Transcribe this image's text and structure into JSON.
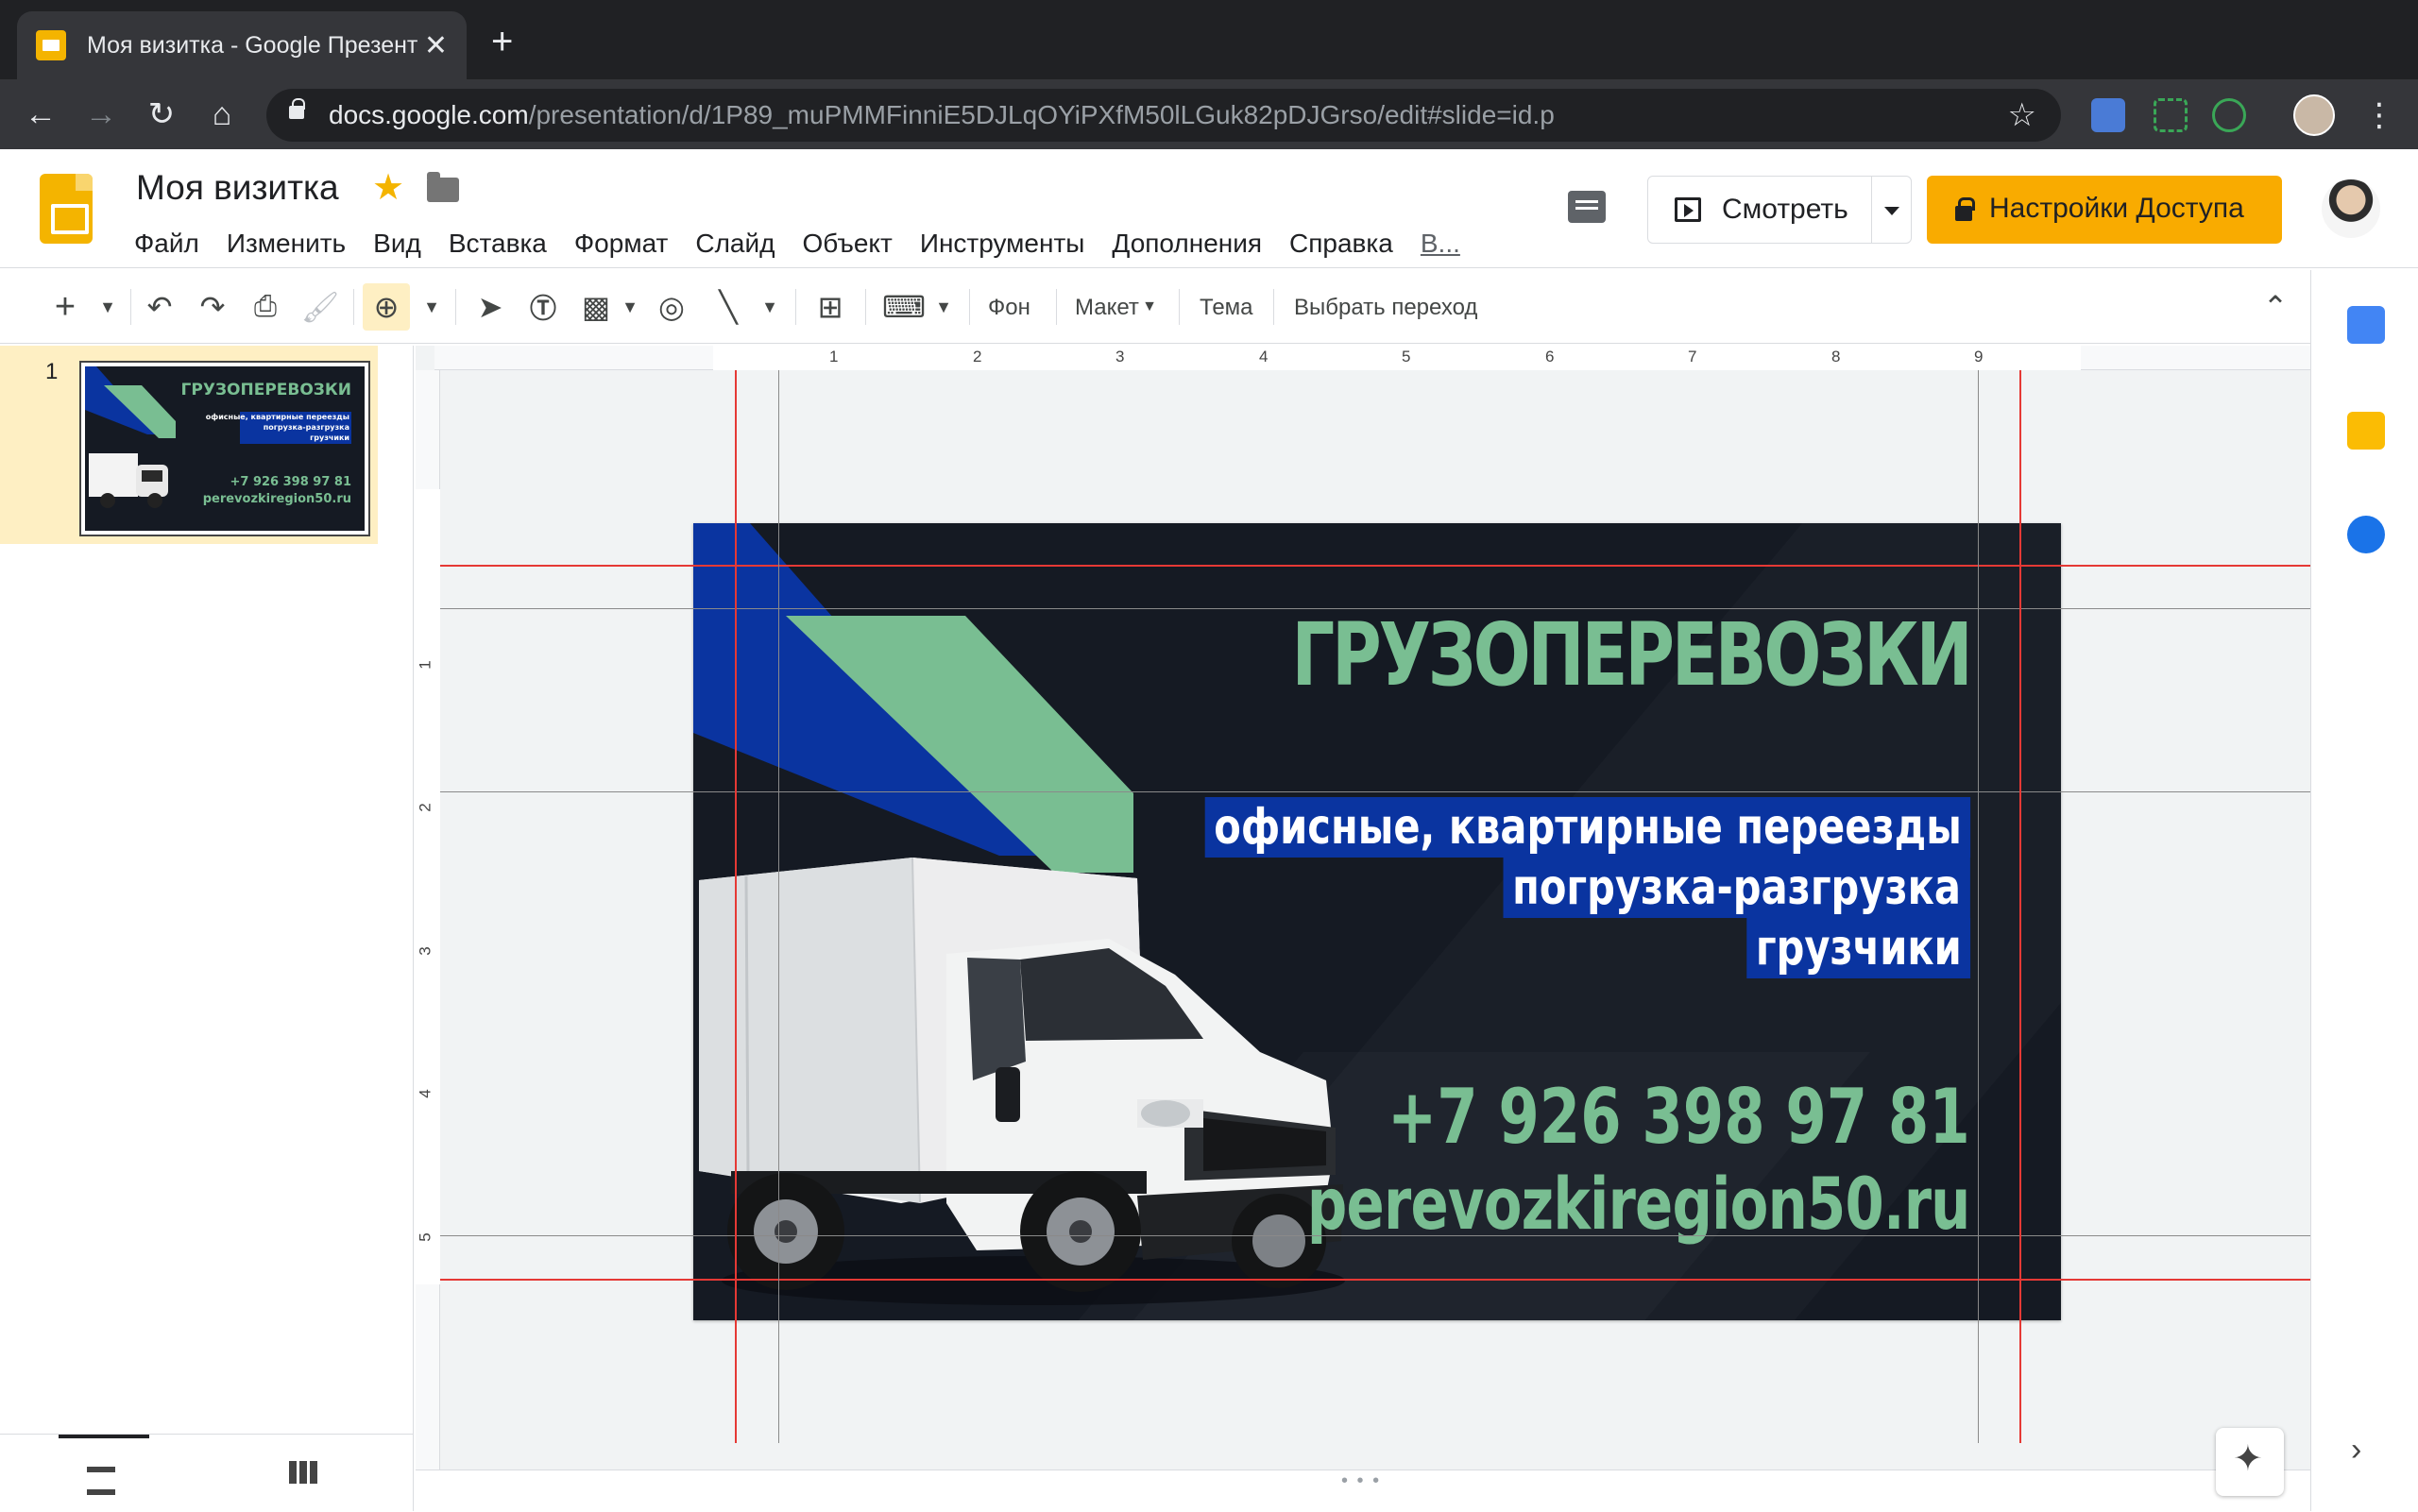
{
  "browser": {
    "tab_title": "Моя визитка - Google Презентации",
    "new_tab": "+",
    "url_host": "docs.google.com",
    "url_path": "/presentation/d/1P89_muPMMFinniE5DJLqOYiPXfM50lLGuk82pDJGrso/edit#slide=id.p"
  },
  "header": {
    "doc_title": "Моя визитка",
    "menu": [
      "Файл",
      "Изменить",
      "Вид",
      "Вставка",
      "Формат",
      "Слайд",
      "Объект",
      "Инструменты",
      "Дополнения",
      "Справка",
      "В..."
    ],
    "present_label": "Смотреть",
    "share_label": "Настройки Доступа"
  },
  "toolbar": {
    "background_label": "Фон",
    "layout_label": "Макет",
    "theme_label": "Тема",
    "transition_label": "Выбрать переход"
  },
  "filmstrip": {
    "slide_number": "1"
  },
  "ruler": {
    "top_ticks": [
      "1",
      "2",
      "3",
      "4",
      "5",
      "6",
      "7",
      "8",
      "9"
    ],
    "left_ticks": [
      "1",
      "2",
      "3",
      "4",
      "5"
    ]
  },
  "slide": {
    "title": "ГРУЗОПЕРЕВОЗКИ",
    "services": [
      "офисные, квартирные переезды",
      "погрузка-разгрузка",
      "грузчики"
    ],
    "phone": "+7 926 398 97 81",
    "website": "perevozkiregion50.ru"
  },
  "colors": {
    "slide_bg": "#151a23",
    "accent_green": "#79be92",
    "accent_blue": "#0a34a0",
    "share_button": "#f9ab00",
    "guide_red": "#e53935"
  }
}
